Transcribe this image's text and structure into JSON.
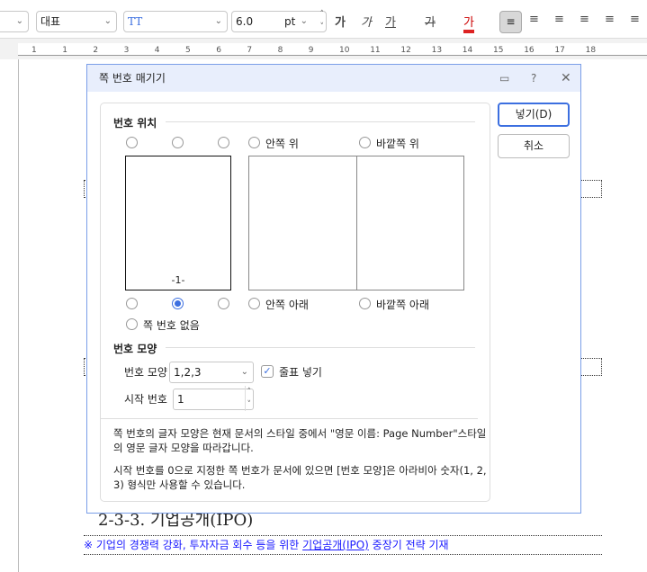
{
  "toolbar": {
    "style_value": "",
    "font_lang": "대표",
    "font_name": "",
    "font_size": "6.0",
    "font_unit": "pt",
    "buttons": [
      "가",
      "가",
      "가",
      "가",
      "가"
    ],
    "ruler_numbers": [
      "1",
      "1",
      "2",
      "3",
      "4",
      "5",
      "6",
      "7",
      "8",
      "9",
      "10",
      "11",
      "12",
      "13",
      "14",
      "15",
      "16",
      "17",
      "18"
    ]
  },
  "document": {
    "heading": "2-3-3. 기업공개(IPO)",
    "note_prefix": "※ 기업의 경쟁력 강화, 투자자금 회수 등을 위한 ",
    "note_link": "기업공개(IPO)",
    "note_suffix": " 중장기 전략 기재",
    "note_color": "#1a1aff"
  },
  "dialog": {
    "title": "쪽 번호 매기기",
    "insert_label": "넣기(D)",
    "cancel_label": "취소",
    "position": {
      "heading": "번호 위치",
      "inner_top": "안쪽 위",
      "outer_top": "바깥쪽 위",
      "inner_bottom": "안쪽 아래",
      "outer_bottom": "바깥쪽 아래",
      "none": "쪽 번호 없음",
      "preview_number": "-1-",
      "selected": "bottom-center"
    },
    "format": {
      "heading": "번호 모양",
      "shape_label": "번호 모양",
      "shape_value": "1,2,3",
      "dash_label": "줄표 넣기",
      "dash_checked": true,
      "start_label": "시작 번호",
      "start_value": "1"
    },
    "notes": [
      "쪽 번호의 글자 모양은 현재 문서의 스타일 중에서 \"영문 이름: Page Number\"스타일의 영문 글자 모양을 따라갑니다.",
      "시작 번호를 0으로 지정한 쪽 번호가 문서에 있으면 [번호 모양]은 아라비아 숫자(1, 2, 3) 형식만 사용할 수 있습니다."
    ]
  },
  "colors": {
    "accent": "#3c6fe0",
    "title_bg": "#e8eefc"
  }
}
